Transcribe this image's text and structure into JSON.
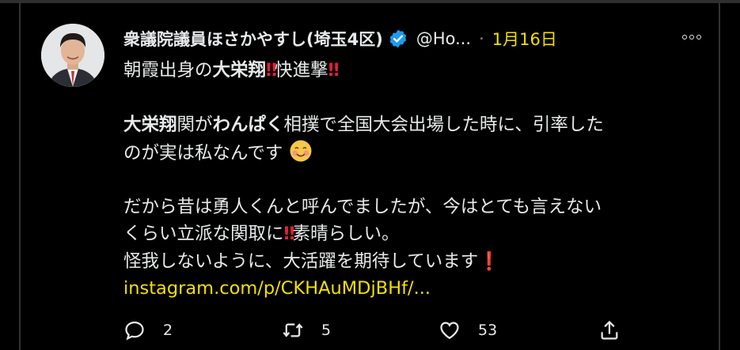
{
  "tweet": {
    "display_name": "衆議院議員ほさかやすし(埼玉4区)",
    "handle": "@Ho...",
    "separator": "·",
    "date": "1月16日",
    "body": {
      "line1_a": "朝霞出身の",
      "line1_b": "大栄翔",
      "line1_c": "快進撃",
      "line2_a": "大栄翔",
      "line2_b": "関が",
      "line2_c": "わんぱく",
      "line2_d": "相撲で全国大会出場した時に、引率した",
      "line3": "のが実は私なんです",
      "line4": "だから昔は勇人くんと呼んでましたが、今はとても言えない",
      "line5_a": "くらい立派な関取に",
      "line5_b": "素晴らしい。",
      "line6": "怪我しないように、大活躍を期待しています",
      "link": "instagram.com/p/CKHAuMDjBHf/..."
    },
    "emoji_double_bang": "‼",
    "emoji_single_bang": "❗"
  },
  "actions": {
    "reply_count": "2",
    "retweet_count": "5",
    "like_count": "53"
  },
  "colors": {
    "background": "#000000",
    "text": "#e7e9ea",
    "accent_link": "#f2e000",
    "verified": "#1d9bf0",
    "emoji_red": "#e0203a"
  }
}
